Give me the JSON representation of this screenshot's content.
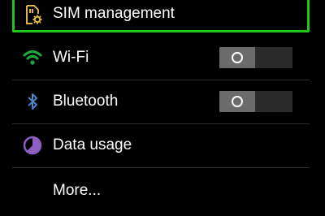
{
  "settings": {
    "items": [
      {
        "label": "SIM management",
        "icon": "sim-settings-icon",
        "highlighted": true
      },
      {
        "label": "Wi-Fi",
        "icon": "wifi-icon",
        "toggle": "off"
      },
      {
        "label": "Bluetooth",
        "icon": "bluetooth-icon",
        "toggle": "off"
      },
      {
        "label": "Data usage",
        "icon": "data-usage-icon"
      },
      {
        "label": "More...",
        "icon": ""
      }
    ],
    "toggle_off_glyph": "O"
  },
  "colors": {
    "highlight": "#22c41e",
    "wifi": "#1fa63a",
    "bluetooth": "#4a86c8",
    "data_usage": "#8b5fc4",
    "sim_icon": "#e0b34a"
  }
}
